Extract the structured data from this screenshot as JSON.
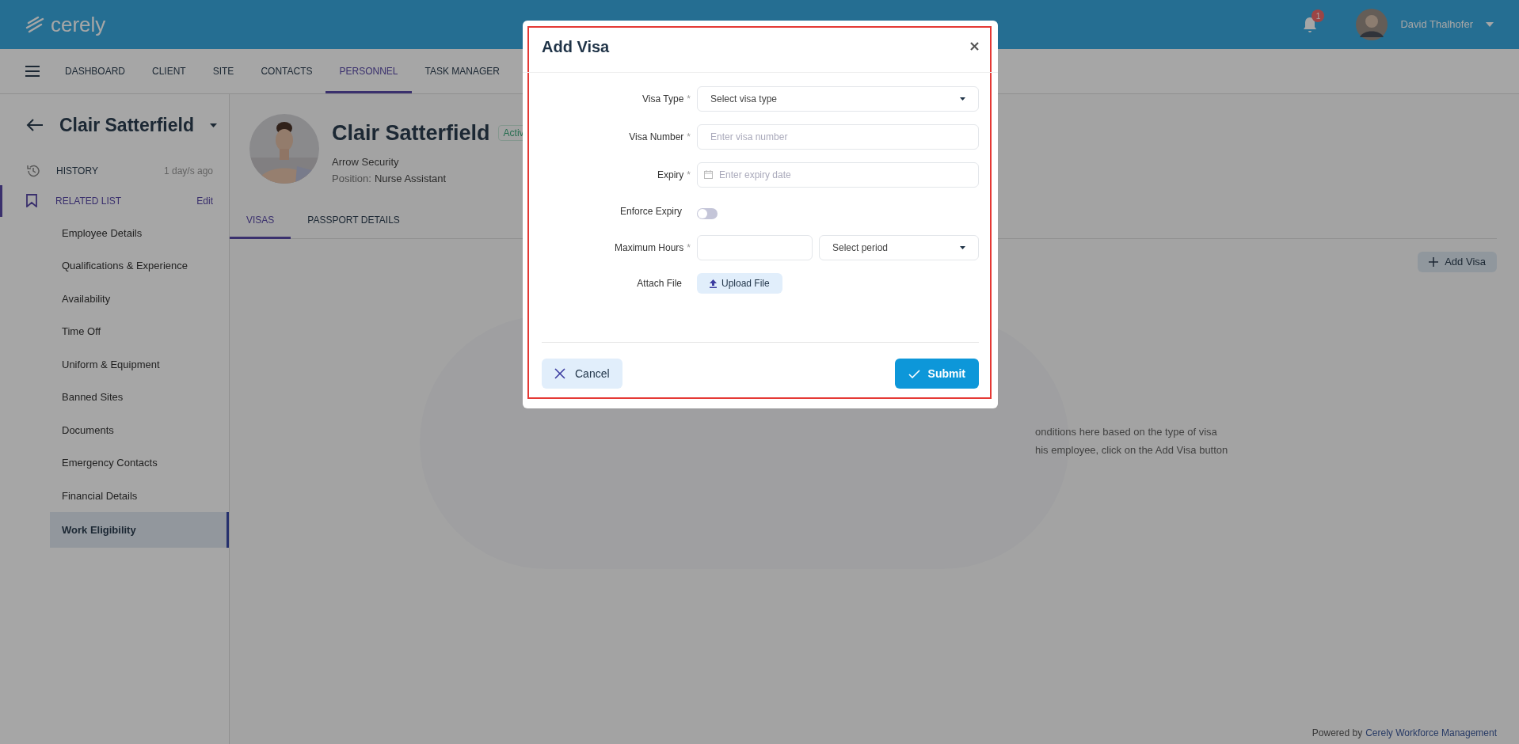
{
  "header": {
    "logo_text": "cerely",
    "notification_count": "1",
    "user_name": "David Thalhofer"
  },
  "nav": [
    {
      "label": "DASHBOARD",
      "selected": false
    },
    {
      "label": "CLIENT",
      "selected": false
    },
    {
      "label": "SITE",
      "selected": false
    },
    {
      "label": "CONTACTS",
      "selected": false
    },
    {
      "label": "PERSONNEL",
      "selected": true
    },
    {
      "label": "TASK MANAGER",
      "selected": false
    }
  ],
  "sidebar": {
    "title": "Clair Satterfield",
    "history": {
      "label": "HISTORY",
      "time": "1 day/s ago"
    },
    "related_list": {
      "label": "RELATED LIST",
      "edit": "Edit",
      "selected": true
    },
    "items": [
      {
        "label": "Employee Details",
        "selected": false
      },
      {
        "label": "Qualifications & Experience",
        "selected": false
      },
      {
        "label": "Availability",
        "selected": false
      },
      {
        "label": "Time Off",
        "selected": false
      },
      {
        "label": "Uniform & Equipment",
        "selected": false
      },
      {
        "label": "Banned Sites",
        "selected": false
      },
      {
        "label": "Documents",
        "selected": false
      },
      {
        "label": "Emergency Contacts",
        "selected": false
      },
      {
        "label": "Financial Details",
        "selected": false
      },
      {
        "label": "Work Eligibility",
        "selected": true
      }
    ]
  },
  "profile": {
    "name": "Clair Satterfield",
    "status": "Activ",
    "company": "Arrow Security",
    "position_label": "Position:",
    "position": "Nurse Assistant"
  },
  "tabs": [
    {
      "label": "VISAS",
      "selected": true
    },
    {
      "label": "PASSPORT DETAILS",
      "selected": false
    }
  ],
  "add_button": "Add Visa",
  "empty_text": [
    "onditions here based on the type of visa",
    "his employee, click on the Add Visa button"
  ],
  "footer": {
    "prefix": "Powered by",
    "link": "Cerely Workforce Management"
  },
  "modal": {
    "title": "Add Visa",
    "fields": [
      {
        "kind": "select",
        "label": "Visa Type",
        "required": true,
        "placeholder": "Select visa type"
      },
      {
        "kind": "text",
        "label": "Visa Number",
        "required": true,
        "placeholder": "Enter visa number"
      },
      {
        "kind": "date",
        "label": "Expiry",
        "required": true,
        "placeholder": "Enter expiry date"
      },
      {
        "kind": "toggle",
        "label": "Enforce Expiry",
        "required": false,
        "on": false
      },
      {
        "kind": "number_select",
        "label": "Maximum Hours",
        "required": true,
        "period_placeholder": "Select period"
      },
      {
        "kind": "upload",
        "label": "Attach File",
        "required": false,
        "button": "Upload File"
      }
    ],
    "required_mark": "*",
    "cancel": "Cancel",
    "submit": "Submit"
  }
}
